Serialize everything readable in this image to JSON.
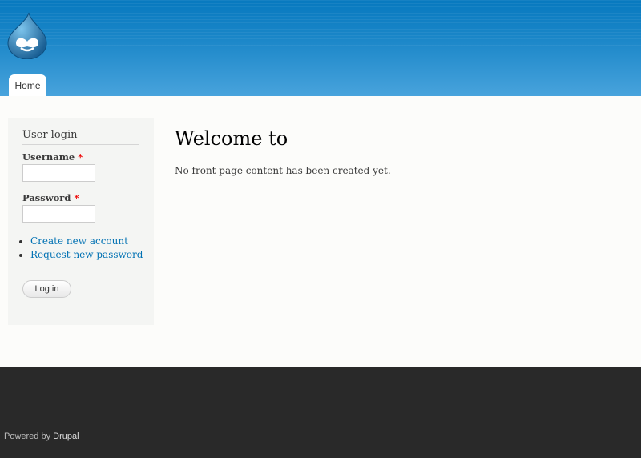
{
  "header": {
    "logo": "drupal-drop-logo",
    "nav": [
      {
        "label": "Home"
      }
    ]
  },
  "sidebar": {
    "title": "User login",
    "username_label": "Username",
    "password_label": "Password",
    "required_mark": "*",
    "username_value": "",
    "password_value": "",
    "links": [
      {
        "label": "Create new account"
      },
      {
        "label": "Request new password"
      }
    ],
    "login_button": "Log in"
  },
  "main": {
    "title": "Welcome to",
    "message": "No front page content has been created yet."
  },
  "footer": {
    "powered_prefix": "Powered by",
    "powered_link": "Drupal"
  }
}
